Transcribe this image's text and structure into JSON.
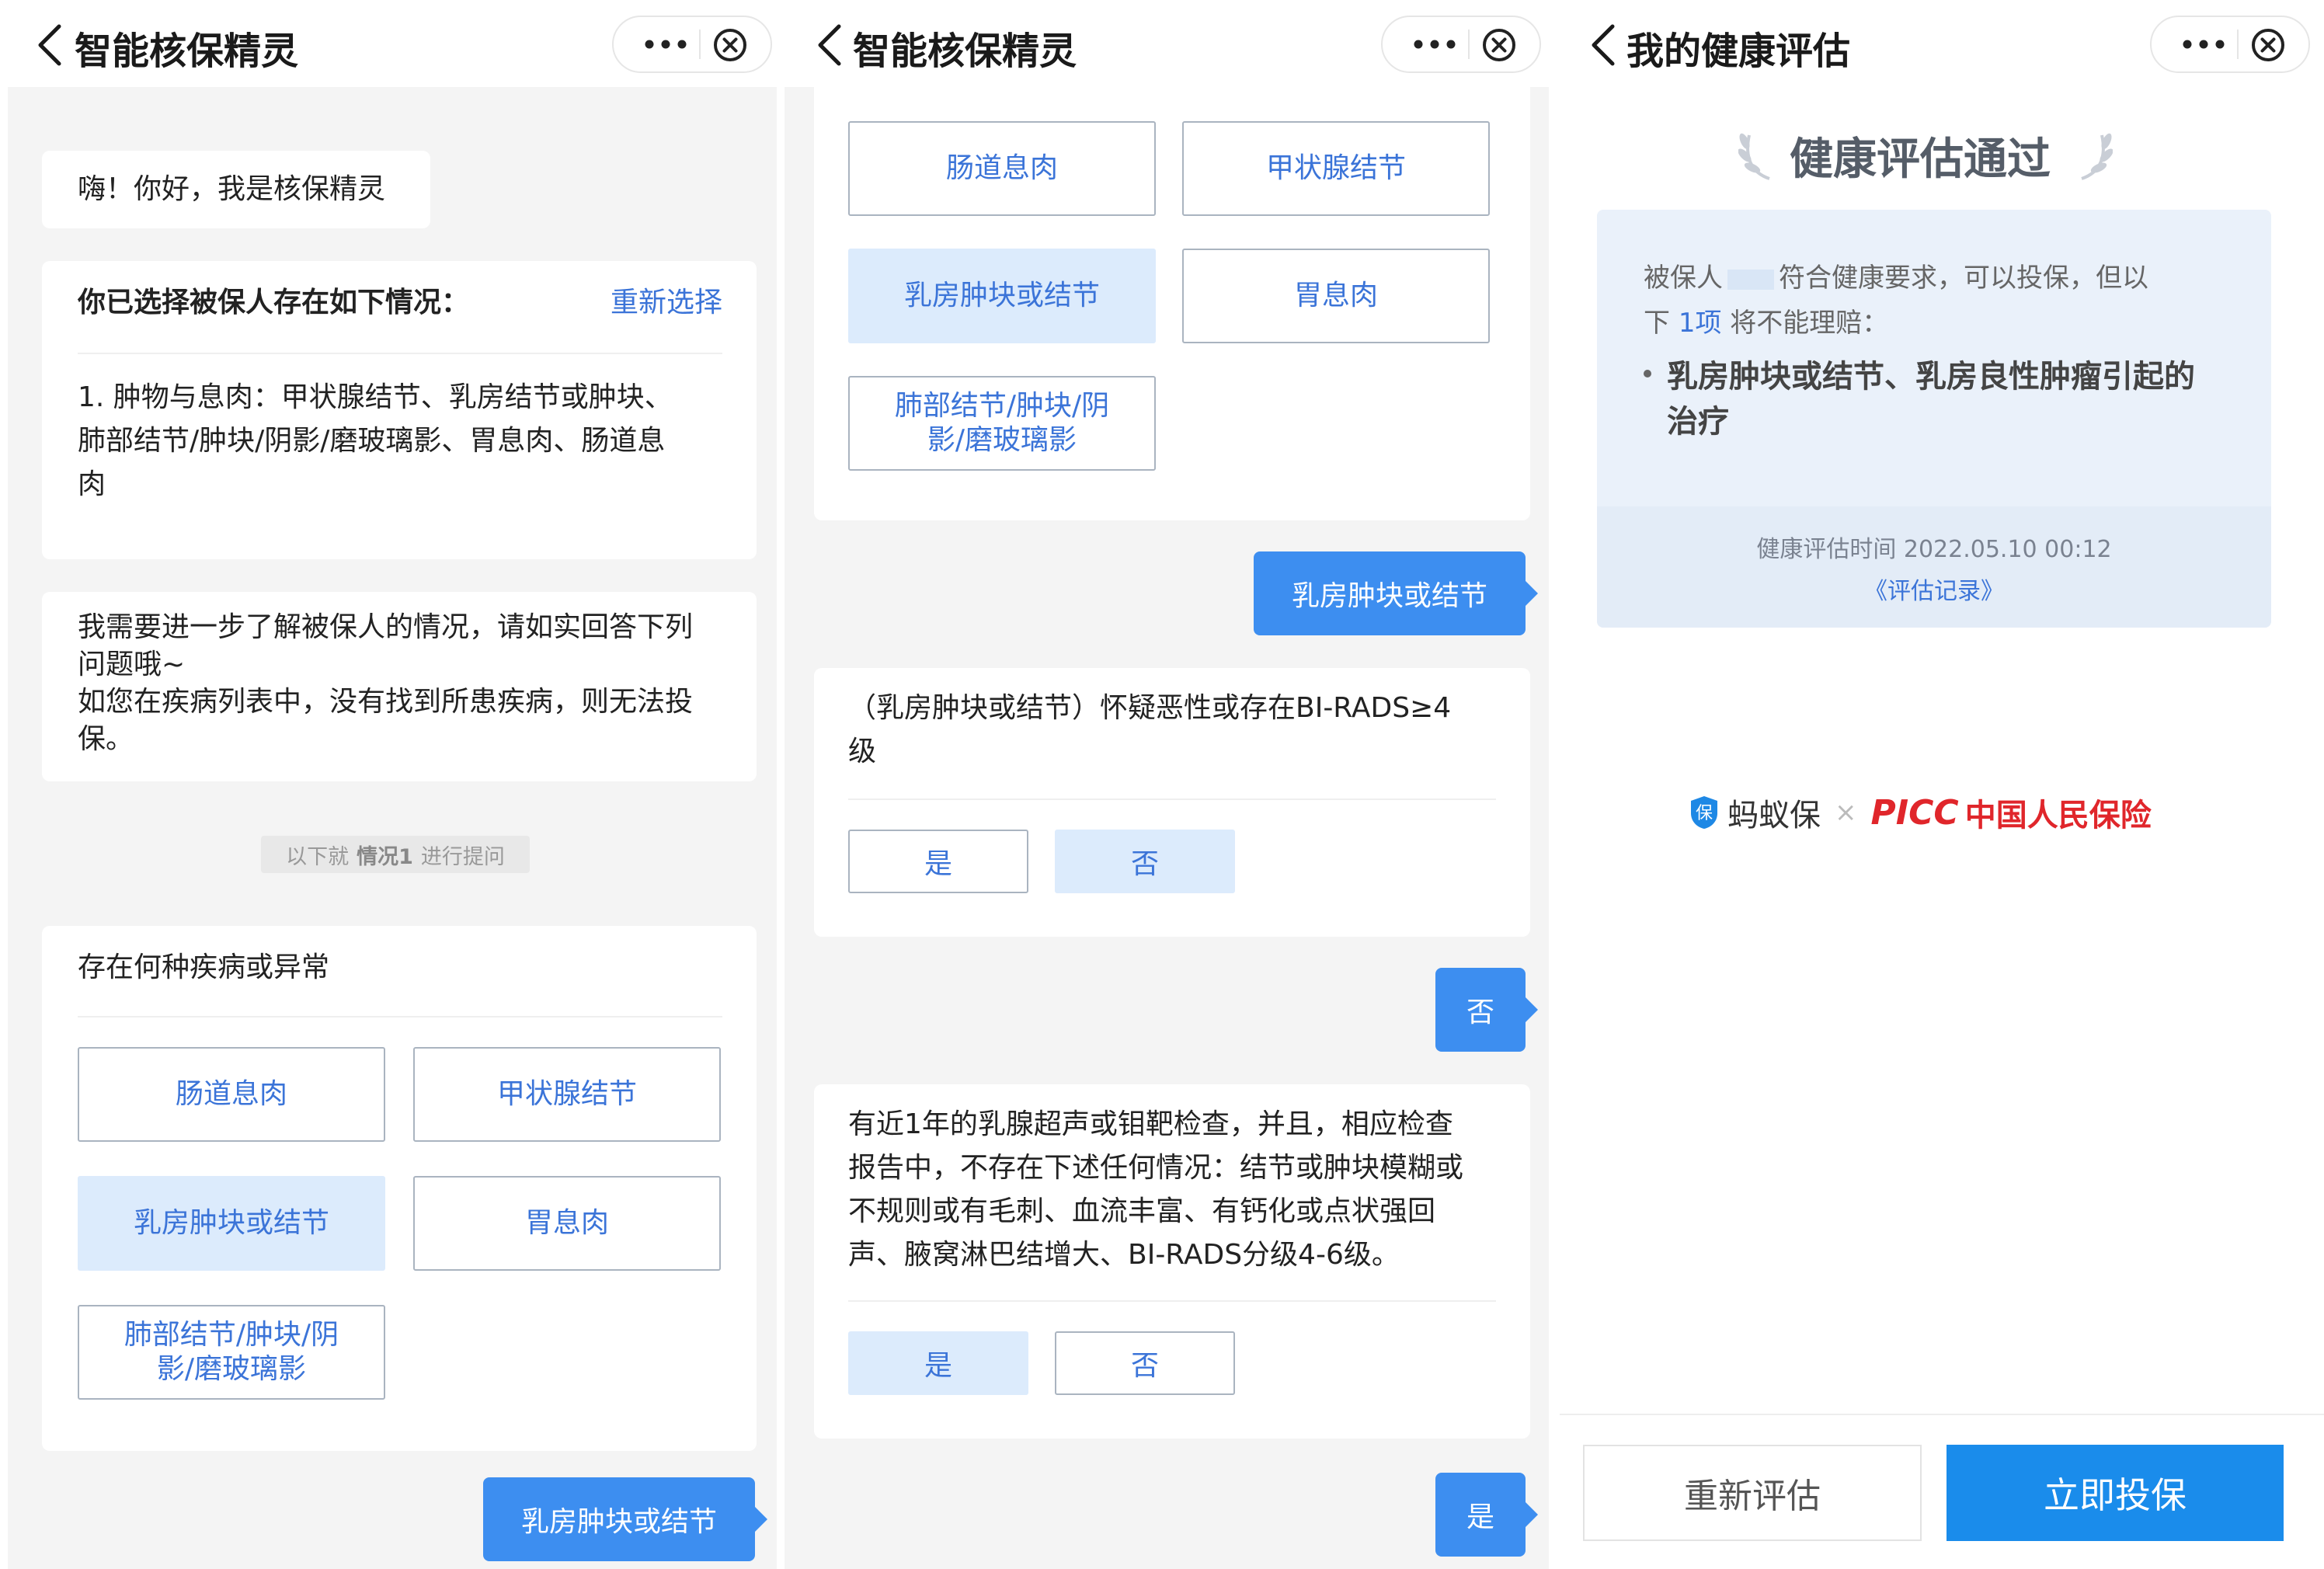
{
  "panel1": {
    "title": "智能核保精灵",
    "greeting": "嗨！你好，我是核保精灵",
    "selected_title": "你已选择被保人存在如下情况：",
    "reselect": "重新选择",
    "selected_line1": "1.  肿物与息肉：甲状腺结节、乳房结节或肿块、",
    "selected_line2": "肺部结节/肿块/阴影/磨玻璃影、胃息肉、肠道息",
    "selected_line3": "肉",
    "intro_line1": "我需要进一步了解被保人的情况，请如实回答下列",
    "intro_line2": "问题哦~",
    "intro_line3": "如您在疾病列表中，没有找到所患疾病，则无法投",
    "intro_line4": "保。",
    "hint_pre": "以下就",
    "hint_bold": "情况1",
    "hint_post": "进行提问",
    "question": "存在何种疾病或异常",
    "options": [
      "肠道息肉",
      "甲状腺结节",
      "乳房肿块或结节",
      "胃息肉"
    ],
    "option5_line1": "肺部结节/肿块/阴",
    "option5_line2": "影/磨玻璃影",
    "reply": "乳房肿块或结节"
  },
  "panel2": {
    "title": "智能核保精灵",
    "options": [
      "肠道息肉",
      "甲状腺结节",
      "乳房肿块或结节",
      "胃息肉"
    ],
    "option5_line1": "肺部结节/肿块/阴",
    "option5_line2": "影/磨玻璃影",
    "reply1": "乳房肿块或结节",
    "q1_line1": "（乳房肿块或结节）怀疑恶性或存在BI-RADS≥4",
    "q1_line2": "级",
    "yes": "是",
    "no": "否",
    "reply2": "否",
    "q2_line1": "有近1年的乳腺超声或钼靶检查，并且，相应检查",
    "q2_line2": "报告中，不存在下述任何情况：结节或肿块模糊或",
    "q2_line3": "不规则或有毛刺、血流丰富、有钙化或点状强回",
    "q2_line4": "声、腋窝淋巴结增大、BI-RADS分级4-6级。",
    "reply3": "是"
  },
  "panel3": {
    "title": "我的健康评估",
    "result": "健康评估通过",
    "line1_pre": "被保人",
    "line1_post": "符合健康要求，可以投保，但以",
    "line2_pre": "下",
    "line2_count": "1项",
    "line2_post": "将不能理赔：",
    "bullet_line1": "乳房肿块或结节、乳房良性肿瘤引起的",
    "bullet_line2": "治疗",
    "eval_time": "健康评估时间 2022.05.10 00:12",
    "record_link": "《评估记录》",
    "brand1": "蚂蚁保",
    "brand_x": "×",
    "brand2_logo": "PICC",
    "brand2_name": "中国人民保险",
    "re_eval": "重新评估",
    "buy_now": "立即投保"
  },
  "colors": {
    "accent": "#3d8ef0",
    "link": "#3b74d8",
    "selected_fill": "#dcebfc",
    "picc_red": "#e0262b"
  }
}
